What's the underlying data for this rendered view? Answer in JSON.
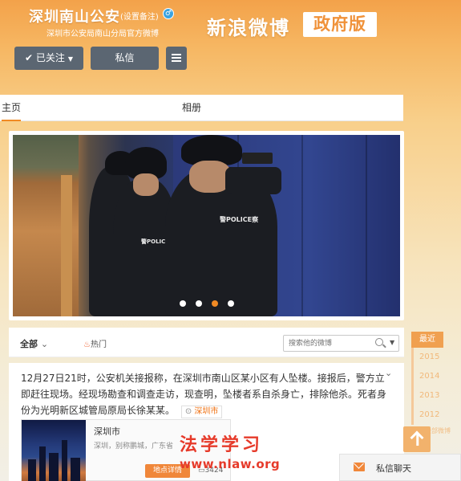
{
  "header": {
    "account_name": "深圳南山公安",
    "remark_link": "(设置备注)",
    "verify_icon": "verified-user-icon",
    "account_desc": "深圳市公安局南山分局官方微博",
    "brand": "新浪微博",
    "brand_badge": "政府版",
    "follow_label": "✔ 已关注",
    "message_label": "私信",
    "colors": {
      "accent": "#f08a24",
      "button": "#5b6672"
    }
  },
  "tabs": [
    {
      "label": "主页",
      "active": true
    },
    {
      "label": "相册",
      "active": false
    }
  ],
  "carousel": {
    "slide_count": 4,
    "active_index": 2,
    "slide_vest_text": "警POLICE察"
  },
  "feed": {
    "filter_all": "全部",
    "filter_hot": "热门",
    "search_placeholder": "搜索他的微博"
  },
  "post": {
    "text": "12月27日21时，公安机关接报称，在深圳市南山区某小区有人坠楼。接报后，警方立即赶往现场。经现场勘查和调查走访，现查明，坠楼者系自杀身亡，排除他杀。死者身份为光明新区城管局原局长徐某某。",
    "location": "深圳市",
    "link_card": {
      "title": "深圳市",
      "subtitle": "深圳，别称鹏城，广东省",
      "button": "地点详情",
      "count": "3424"
    }
  },
  "timeline": {
    "head": "最近",
    "years": [
      "2015",
      "2014",
      "2013",
      "2012"
    ],
    "more": "全部微博"
  },
  "chat": {
    "label": "私信聊天"
  },
  "watermark": {
    "text": "法学学习",
    "url": "www.nlaw.org"
  }
}
